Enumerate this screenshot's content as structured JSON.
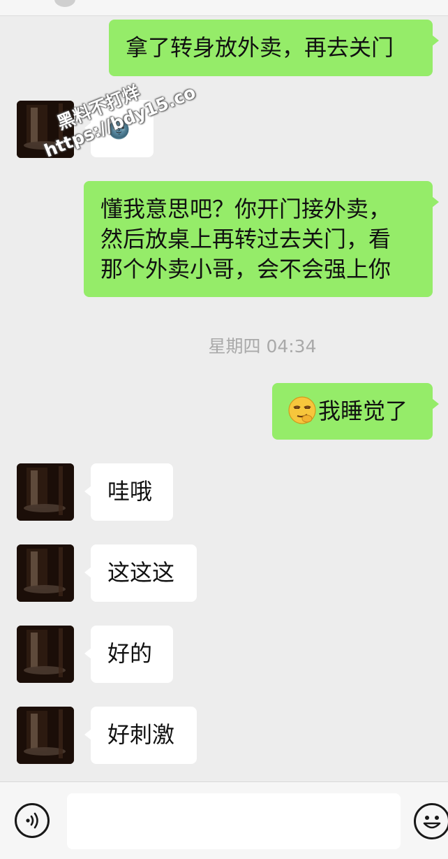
{
  "messages": [
    {
      "direction": "out",
      "text": "拿了转身放外卖，再去关门"
    },
    {
      "direction": "in",
      "text": "🌚"
    },
    {
      "direction": "out",
      "lines": [
        "懂我意思吧？你开门接外卖，",
        "然后放桌上再转过去关门，看",
        "那个外卖小哥，会不会强上你"
      ]
    },
    {
      "direction": "out",
      "emoji": "smirk-emoji",
      "text": "我睡觉了"
    },
    {
      "direction": "in",
      "text": "哇哦"
    },
    {
      "direction": "in",
      "text": "这这这"
    },
    {
      "direction": "in",
      "text": "好的"
    },
    {
      "direction": "in",
      "text": "好刺激"
    }
  ],
  "timestamp": "星期四 04:34",
  "watermark": {
    "line1": "黑料不打烊",
    "line2": "https://bdy15.co"
  },
  "input_bar": {
    "value": "",
    "icons": [
      "voice-icon",
      "emoji-face-icon"
    ]
  },
  "colors": {
    "background": "#ededed",
    "outgoing_bubble": "#95ec69",
    "incoming_bubble": "#ffffff",
    "timestamp": "#a9a9a9"
  }
}
